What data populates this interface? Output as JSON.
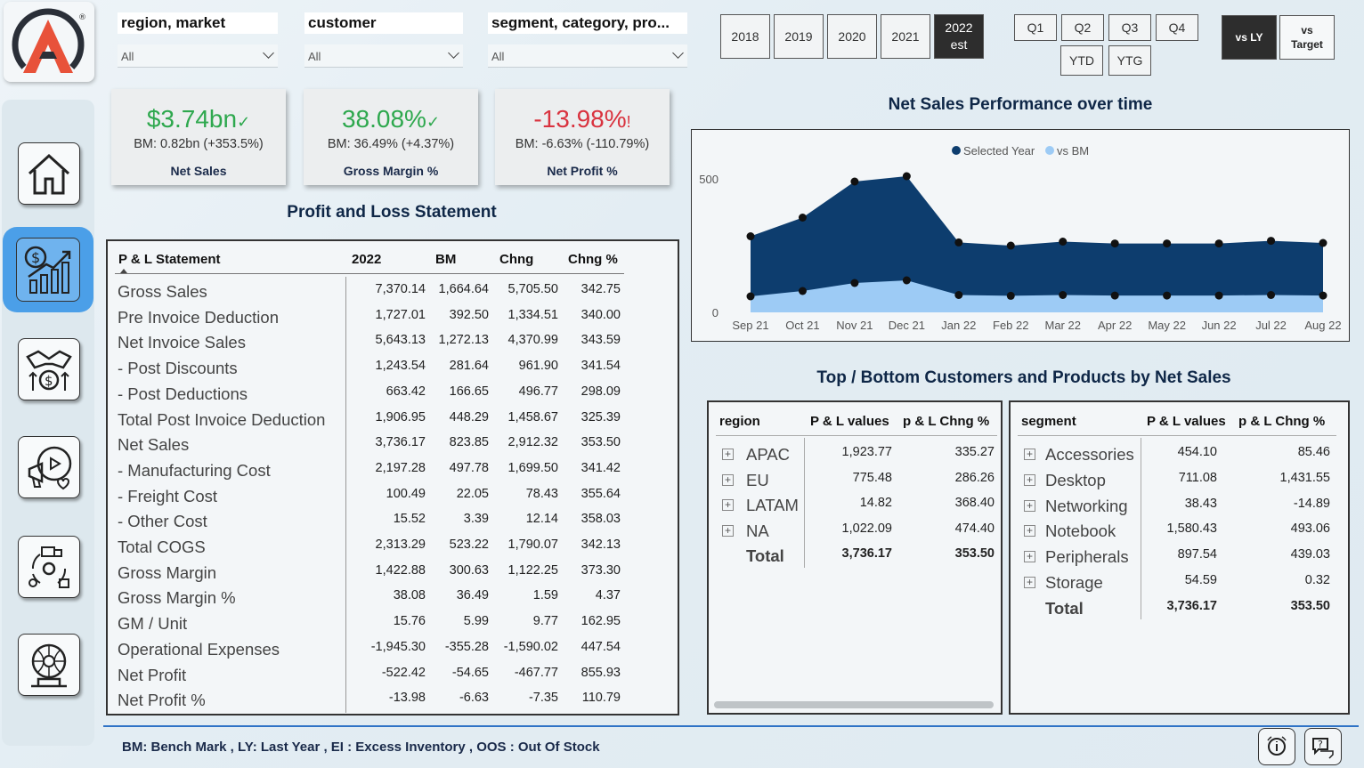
{
  "filters": [
    {
      "label": "region, market",
      "value": "All"
    },
    {
      "label": "customer",
      "value": "All"
    },
    {
      "label": "segment, category, pro...",
      "value": "All"
    }
  ],
  "years": [
    {
      "label": "2018",
      "selected": false
    },
    {
      "label": "2019",
      "selected": false
    },
    {
      "label": "2020",
      "selected": false
    },
    {
      "label": "2021",
      "selected": false
    },
    {
      "label": "2022",
      "sub": "est",
      "selected": true
    }
  ],
  "quarters_row1": [
    "Q1",
    "Q2",
    "Q3",
    "Q4"
  ],
  "quarters_row2": [
    "YTD",
    "YTG"
  ],
  "compare": {
    "vs_ly": "vs LY",
    "vs_target_1": "vs",
    "vs_target_2": "Target"
  },
  "kpis": [
    {
      "value": "$3.74bn",
      "mark": "✓",
      "bm": "BM: 0.82bn (+353.5%)",
      "label": "Net Sales",
      "color": "#2ea84e"
    },
    {
      "value": "38.08%",
      "mark": "✓",
      "bm": "BM: 36.49% (+4.37%)",
      "label": "Gross Margin %",
      "color": "#2ea84e"
    },
    {
      "value": "-13.98%",
      "mark": "!",
      "bm": "BM: -6.63% (-110.79%)",
      "label": "Net Profit %",
      "color": "#d9333f"
    }
  ],
  "pl": {
    "title": "Profit and Loss Statement",
    "headers": [
      "P & L Statement",
      "2022",
      "BM",
      "Chng",
      "Chng %"
    ],
    "rows": [
      [
        "Gross Sales",
        "7,370.14",
        "1,664.64",
        "5,705.50",
        "342.75"
      ],
      [
        "Pre Invoice Deduction",
        "1,727.01",
        "392.50",
        "1,334.51",
        "340.00"
      ],
      [
        "Net Invoice Sales",
        "5,643.13",
        "1,272.13",
        "4,370.99",
        "343.59"
      ],
      [
        "- Post Discounts",
        "1,243.54",
        "281.64",
        "961.90",
        "341.54"
      ],
      [
        "- Post Deductions",
        "663.42",
        "166.65",
        "496.77",
        "298.09"
      ],
      [
        "Total Post Invoice Deduction",
        "1,906.95",
        "448.29",
        "1,458.67",
        "325.39"
      ],
      [
        "Net Sales",
        "3,736.17",
        "823.85",
        "2,912.32",
        "353.50"
      ],
      [
        "- Manufacturing Cost",
        "2,197.28",
        "497.78",
        "1,699.50",
        "341.42"
      ],
      [
        "- Freight Cost",
        "100.49",
        "22.05",
        "78.43",
        "355.64"
      ],
      [
        "- Other Cost",
        "15.52",
        "3.39",
        "12.14",
        "358.03"
      ],
      [
        "Total COGS",
        "2,313.29",
        "523.22",
        "1,790.07",
        "342.13"
      ],
      [
        "Gross Margin",
        "1,422.88",
        "300.63",
        "1,122.25",
        "373.30"
      ],
      [
        "Gross Margin %",
        "38.08",
        "36.49",
        "1.59",
        "4.37"
      ],
      [
        "GM / Unit",
        "15.76",
        "5.99",
        "9.77",
        "162.95"
      ],
      [
        "Operational Expenses",
        "-1,945.30",
        "-355.28",
        "-1,590.02",
        "447.54"
      ],
      [
        "Net Profit",
        "-522.42",
        "-54.65",
        "-467.77",
        "855.93"
      ],
      [
        "Net Profit %",
        "-13.98",
        "-6.63",
        "-7.35",
        "110.79"
      ]
    ]
  },
  "chart_data": {
    "type": "area",
    "title": "Net Sales Performance over time",
    "categories": [
      "Sep 21",
      "Oct 21",
      "Nov 21",
      "Dec 21",
      "Jan 22",
      "Feb 22",
      "Mar 22",
      "Apr 22",
      "May 22",
      "Jun 22",
      "Jul 22",
      "Aug 22"
    ],
    "series": [
      {
        "name": "Selected Year",
        "color": "#0d3d6e",
        "values": [
          285,
          355,
          490,
          510,
          262,
          250,
          265,
          258,
          258,
          258,
          268,
          260
        ]
      },
      {
        "name": "vs BM",
        "color": "#9dcbf5",
        "values": [
          60,
          80,
          110,
          120,
          65,
          62,
          65,
          63,
          63,
          63,
          65,
          63
        ]
      }
    ],
    "yticks": [
      0,
      500
    ],
    "ylim": [
      0,
      650
    ],
    "legend": "top-center"
  },
  "customers_title": "Top / Bottom Customers and Products by Net Sales",
  "region_table": {
    "headers": [
      "region",
      "P & L values",
      "p & L Chng %"
    ],
    "rows": [
      [
        "APAC",
        "1,923.77",
        "335.27"
      ],
      [
        "EU",
        "775.48",
        "286.26"
      ],
      [
        "LATAM",
        "14.82",
        "368.40"
      ],
      [
        "NA",
        "1,022.09",
        "474.40"
      ]
    ],
    "total": [
      "Total",
      "3,736.17",
      "353.50"
    ]
  },
  "segment_table": {
    "headers": [
      "segment",
      "P & L values",
      "p & L Chng %"
    ],
    "rows": [
      [
        "Accessories",
        "454.10",
        "85.46"
      ],
      [
        "Desktop",
        "711.08",
        "1,431.55"
      ],
      [
        "Networking",
        "38.43",
        "-14.89"
      ],
      [
        "Notebook",
        "1,580.43",
        "493.06"
      ],
      [
        "Peripherals",
        "897.54",
        "439.03"
      ],
      [
        "Storage",
        "54.59",
        "0.32"
      ]
    ],
    "total": [
      "Total",
      "3,736.17",
      "353.50"
    ]
  },
  "footer": "BM: Bench Mark , LY: Last Year , EI : Excess Inventory , OOS : Out Of Stock",
  "icons": [
    "logo-icon",
    "home-icon",
    "finance-icon",
    "sales-icon",
    "marketing-icon",
    "supply-chain-icon",
    "executive-icon",
    "info-icon",
    "help-icon"
  ]
}
